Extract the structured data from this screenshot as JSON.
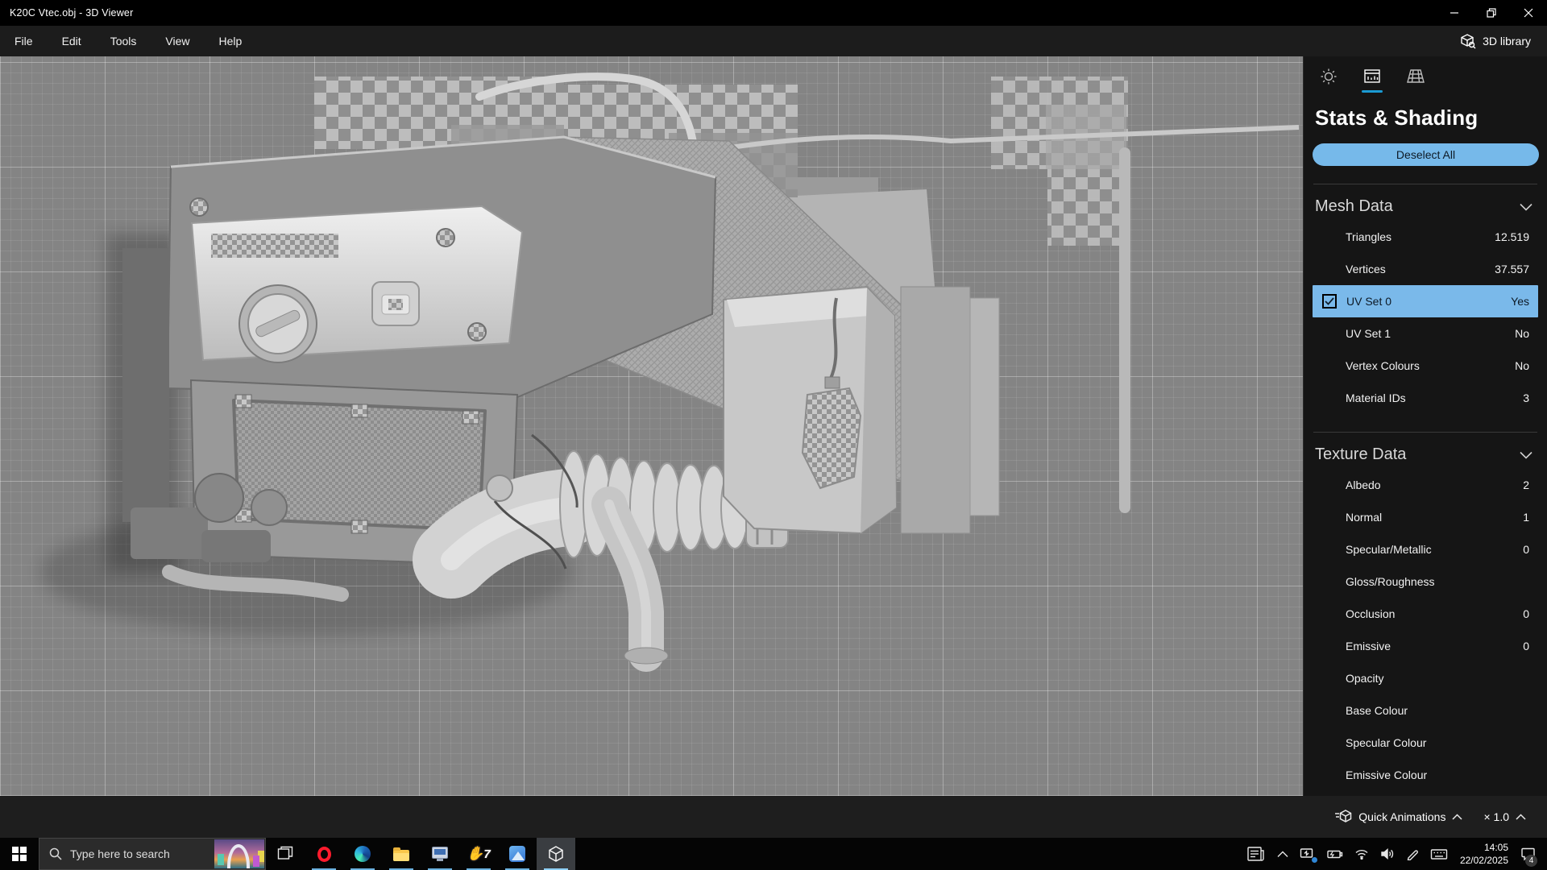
{
  "window": {
    "title": "K20C Vtec.obj - 3D Viewer"
  },
  "menu": {
    "items": [
      "File",
      "Edit",
      "Tools",
      "View",
      "Help"
    ],
    "library_label": "3D library"
  },
  "panel": {
    "title": "Stats & Shading",
    "deselect_label": "Deselect All",
    "mesh": {
      "title": "Mesh Data",
      "rows": [
        {
          "label": "Triangles",
          "value": "12.519"
        },
        {
          "label": "Vertices",
          "value": "37.557"
        },
        {
          "label": "UV Set 0",
          "value": "Yes",
          "selected": true,
          "checked": true
        },
        {
          "label": "UV Set 1",
          "value": "No"
        },
        {
          "label": "Vertex Colours",
          "value": "No"
        },
        {
          "label": "Material IDs",
          "value": "3"
        }
      ]
    },
    "texture": {
      "title": "Texture Data",
      "rows": [
        {
          "label": "Albedo",
          "value": "2"
        },
        {
          "label": "Normal",
          "value": "1"
        },
        {
          "label": "Specular/Metallic",
          "value": "0"
        },
        {
          "label": "Gloss/Roughness",
          "value": ""
        },
        {
          "label": "Occlusion",
          "value": "0"
        },
        {
          "label": "Emissive",
          "value": "0"
        },
        {
          "label": "Opacity",
          "value": ""
        },
        {
          "label": "Base Colour",
          "value": ""
        },
        {
          "label": "Specular Colour",
          "value": ""
        },
        {
          "label": "Emissive Colour",
          "value": ""
        }
      ]
    }
  },
  "bottom_bar": {
    "animations_label": "Quick Animations",
    "speed_label": "× 1.0"
  },
  "taskbar": {
    "search_placeholder": "Type here to search",
    "clock": {
      "time": "14:05",
      "date": "22/02/2025"
    },
    "notification_count": "4"
  },
  "colors": {
    "selection_blue": "#7ab9ea",
    "tab_accent": "#1b9ad2",
    "taskbar_underline": "#6cb2e0",
    "viewport_grid_bg": "#848484"
  }
}
